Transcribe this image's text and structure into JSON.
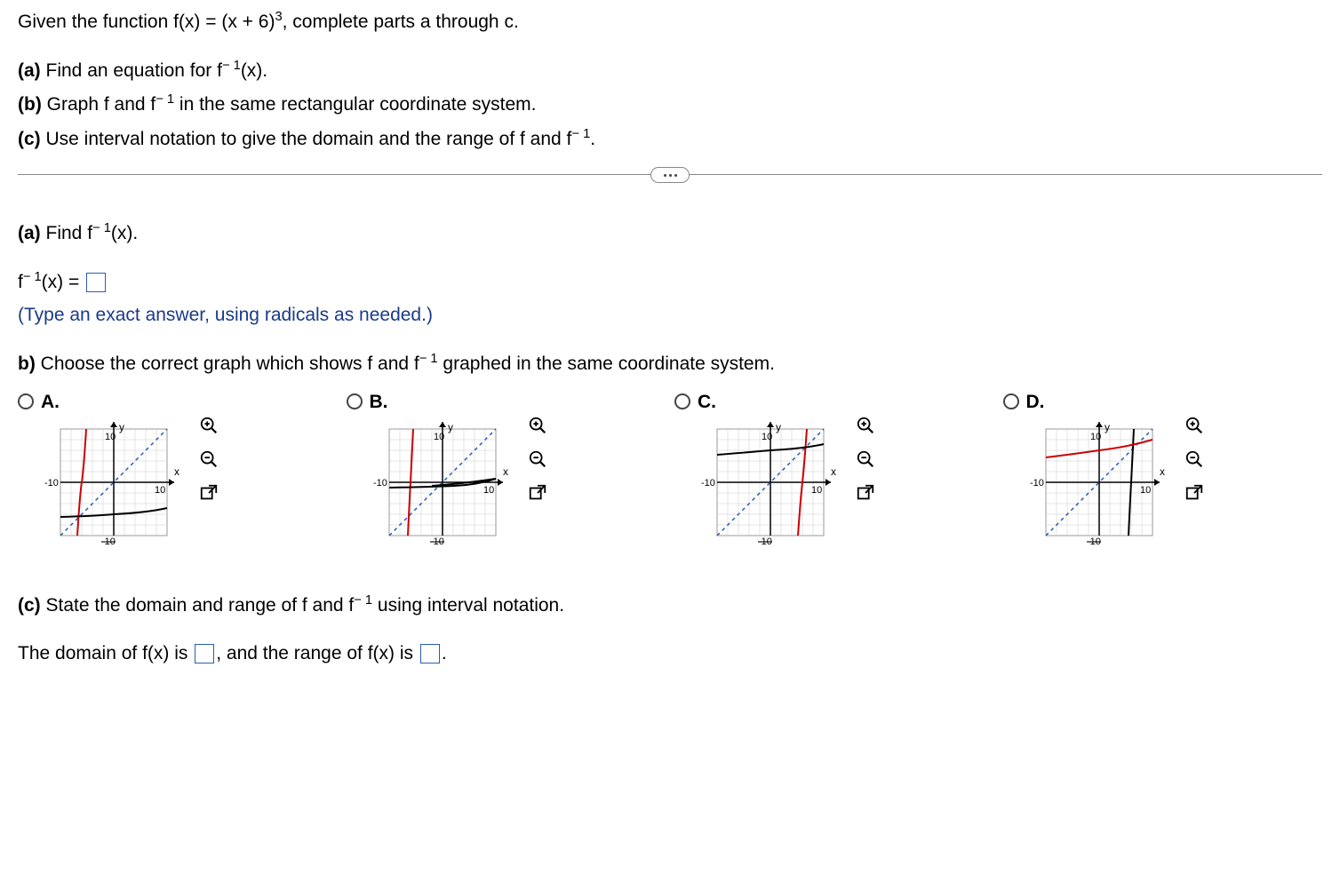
{
  "problem": {
    "intro": "Given the function f(x) = (x + 6)³, complete parts a through c.",
    "parts": {
      "a": "(a) Find an equation for f⁻¹(x).",
      "b": "(b) Graph f and f⁻¹ in the same rectangular coordinate system.",
      "c": "(c) Use interval notation to give the domain and the range of f and f⁻¹."
    }
  },
  "part_a": {
    "prompt": "(a) Find f⁻¹(x).",
    "equation_prefix": "f⁻¹(x) = ",
    "hint": "(Type an exact answer, using radicals as needed.)"
  },
  "part_b": {
    "prompt": "b) Choose the correct graph which shows f and f⁻¹ graphed in the same coordinate system.",
    "options": {
      "a": "A.",
      "b": "B.",
      "c": "C.",
      "d": "D."
    },
    "axis": {
      "y": "y",
      "x": "x",
      "top": "10",
      "bottom": "-10",
      "left": "-10",
      "right": "10"
    }
  },
  "part_c": {
    "prompt": "(c) State the domain and range of f and f⁻¹ using interval notation.",
    "sentence_1": "The domain of f(x) is ",
    "sentence_2": ", and the range of f(x) is ",
    "sentence_3": "."
  },
  "chart_data": [
    {
      "type": "line",
      "option": "A",
      "xlim": [
        -10,
        10
      ],
      "ylim": [
        -10,
        10
      ],
      "series": [
        {
          "name": "f",
          "curve": "cubic",
          "shift": -6,
          "color": "red"
        },
        {
          "name": "f-inv",
          "curve": "cuberoot",
          "shift": -6,
          "color": "black",
          "style": "solid"
        },
        {
          "name": "y=x",
          "curve": "identity",
          "color": "blue",
          "style": "dashed"
        }
      ]
    },
    {
      "type": "line",
      "option": "B",
      "xlim": [
        -10,
        10
      ],
      "ylim": [
        -10,
        10
      ],
      "series": [
        {
          "name": "f",
          "curve": "cubic",
          "shift": -6,
          "color": "red",
          "style": "left-variant"
        },
        {
          "name": "f-inv",
          "curve": "cuberoot",
          "shift": 6,
          "color": "black"
        },
        {
          "name": "y=x",
          "curve": "identity",
          "color": "blue",
          "style": "dashed"
        }
      ]
    },
    {
      "type": "line",
      "option": "C",
      "xlim": [
        -10,
        10
      ],
      "ylim": [
        -10,
        10
      ],
      "series": [
        {
          "name": "f",
          "curve": "cubic",
          "shift": 6,
          "color": "red"
        },
        {
          "name": "f-inv",
          "curve": "cuberoot",
          "shift": 6,
          "color": "black"
        },
        {
          "name": "y=x",
          "curve": "identity",
          "color": "blue",
          "style": "dashed"
        }
      ]
    },
    {
      "type": "line",
      "option": "D",
      "xlim": [
        -10,
        10
      ],
      "ylim": [
        -10,
        10
      ],
      "series": [
        {
          "name": "f",
          "curve": "cuberoot",
          "shift": -6,
          "scaley": 1,
          "color": "red"
        },
        {
          "name": "f-inv",
          "curve": "cubic",
          "shift": 6,
          "color": "black"
        },
        {
          "name": "y=x",
          "curve": "identity",
          "color": "blue",
          "style": "dashed"
        }
      ]
    }
  ]
}
